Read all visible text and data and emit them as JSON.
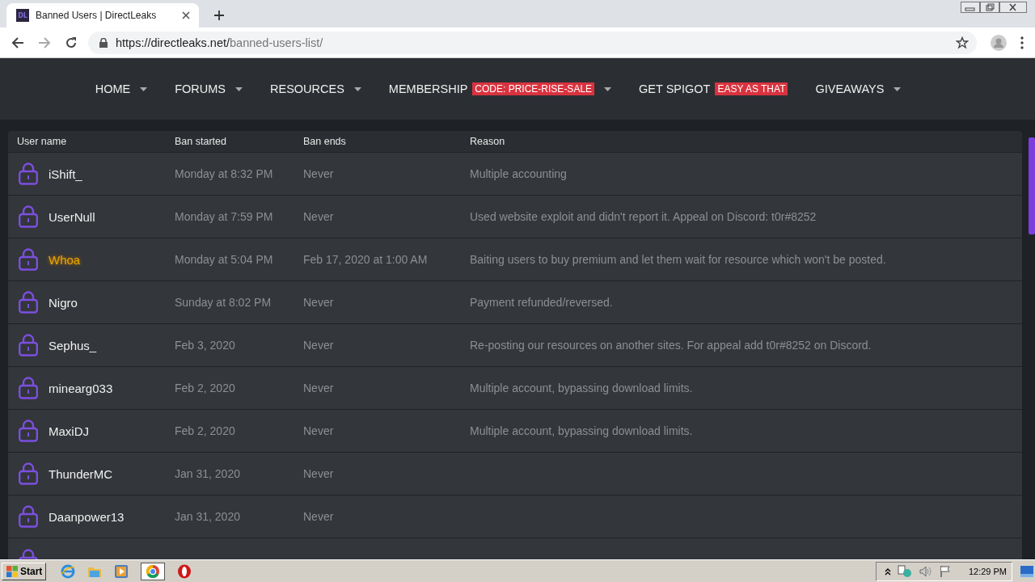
{
  "browser": {
    "tab_title": "Banned Users | DirectLeaks",
    "favicon_text": "DL",
    "url_host": "https://directleaks.net/",
    "url_path": "banned-users-list/"
  },
  "nav": [
    {
      "label": "HOME",
      "dropdown": true
    },
    {
      "label": "FORUMS",
      "dropdown": true
    },
    {
      "label": "RESOURCES",
      "dropdown": true
    },
    {
      "label": "MEMBERSHIP",
      "badge": "CODE: PRICE-RISE-SALE",
      "dropdown": true
    },
    {
      "label": "GET SPIGOT",
      "badge": "EASY AS THAT",
      "dropdown": false
    },
    {
      "label": "GIVEAWAYS",
      "dropdown": true
    }
  ],
  "table": {
    "columns": [
      "User name",
      "Ban started",
      "Ban ends",
      "Reason"
    ],
    "rows": [
      {
        "user": "iShift_",
        "highlighted": false,
        "started": "Monday at 8:32 PM",
        "ends": "Never",
        "reason": "Multiple accounting"
      },
      {
        "user": "UserNull",
        "highlighted": false,
        "started": "Monday at 7:59 PM",
        "ends": "Never",
        "reason": "Used website exploit and didn't report it. Appeal on Discord: t0r#8252"
      },
      {
        "user": "Whoa",
        "highlighted": true,
        "started": "Monday at 5:04 PM",
        "ends": "Feb 17, 2020 at 1:00 AM",
        "reason": "Baiting users to buy premium and let them wait for resource which won't be posted."
      },
      {
        "user": "Nigro",
        "highlighted": false,
        "started": "Sunday at 8:02 PM",
        "ends": "Never",
        "reason": "Payment refunded/reversed."
      },
      {
        "user": "Sephus_",
        "highlighted": false,
        "started": "Feb 3, 2020",
        "ends": "Never",
        "reason": "Re-posting our resources on another sites. For appeal add t0r#8252 on Discord."
      },
      {
        "user": "minearg033",
        "highlighted": false,
        "started": "Feb 2, 2020",
        "ends": "Never",
        "reason": "Multiple account, bypassing download limits."
      },
      {
        "user": "MaxiDJ",
        "highlighted": false,
        "started": "Feb 2, 2020",
        "ends": "Never",
        "reason": "Multiple account, bypassing download limits."
      },
      {
        "user": "ThunderMC",
        "highlighted": false,
        "started": "Jan 31, 2020",
        "ends": "Never"
      },
      {
        "user": "Daanpower13",
        "highlighted": false,
        "started": "Jan 31, 2020",
        "ends": "Never"
      }
    ]
  },
  "taskbar": {
    "start": "Start",
    "clock": "12:29 PM"
  }
}
